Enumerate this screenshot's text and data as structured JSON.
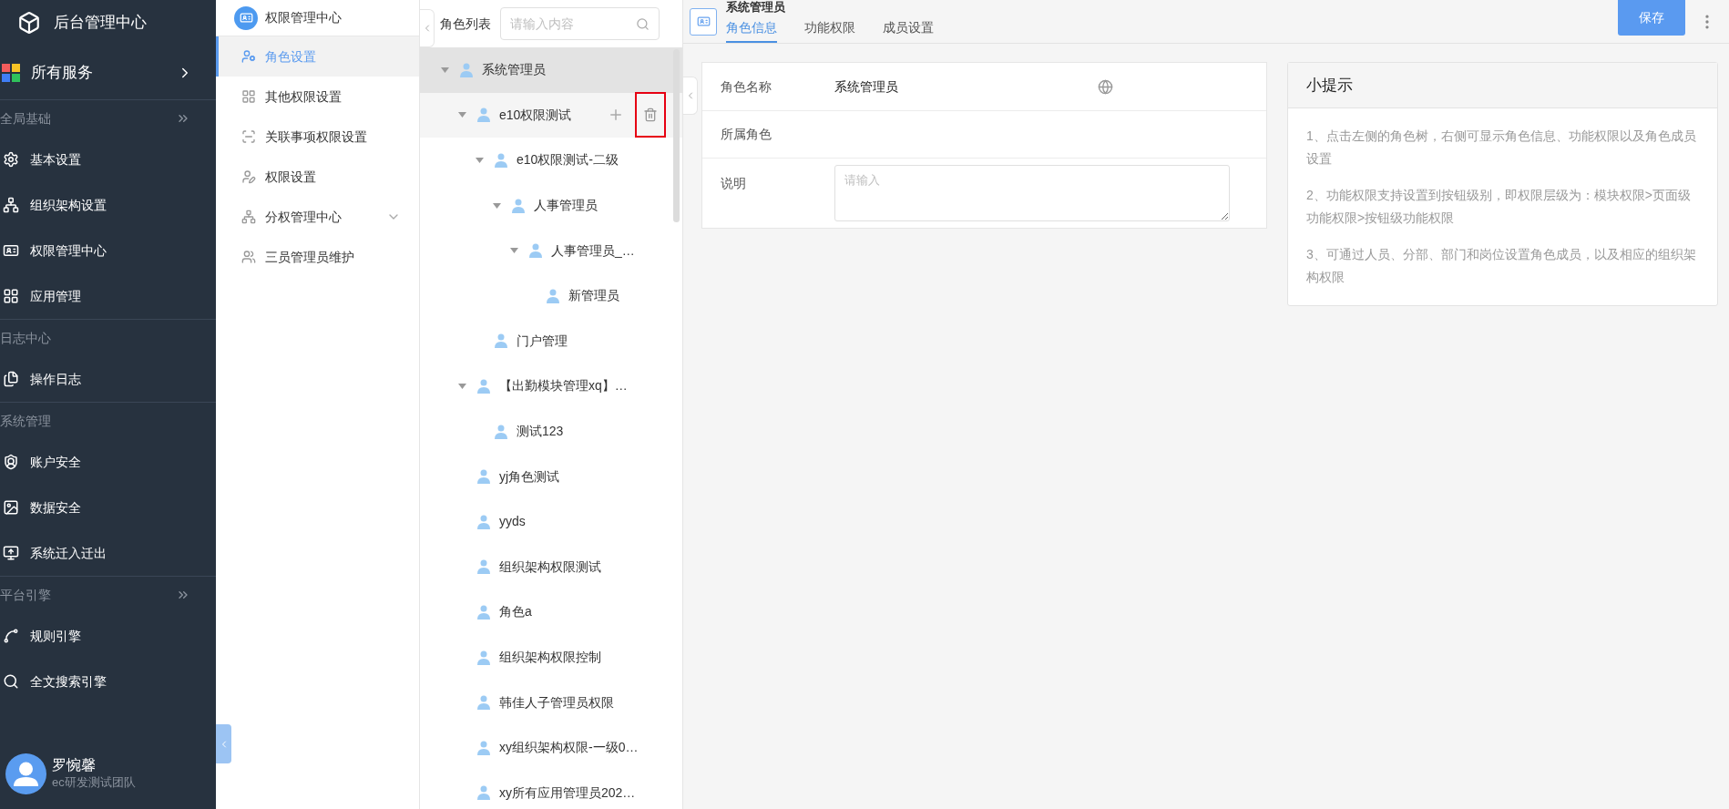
{
  "app": {
    "title": "后台管理中心"
  },
  "all_services": {
    "label": "所有服务"
  },
  "sidebar": {
    "sections": [
      {
        "label": "全局基础",
        "collapsible": true,
        "items": [
          {
            "label": "基本设置",
            "selected": false
          },
          {
            "label": "组织架构设置",
            "selected": false
          },
          {
            "label": "权限管理中心",
            "selected": false
          },
          {
            "label": "应用管理",
            "selected": false
          }
        ]
      },
      {
        "label": "日志中心",
        "collapsible": false,
        "items": [
          {
            "label": "操作日志",
            "selected": false
          }
        ]
      },
      {
        "label": "系统管理",
        "collapsible": false,
        "items": [
          {
            "label": "账户安全",
            "selected": false
          },
          {
            "label": "数据安全",
            "selected": false
          },
          {
            "label": "系统迁入迁出",
            "selected": false
          }
        ]
      },
      {
        "label": "平台引擎",
        "collapsible": true,
        "items": [
          {
            "label": "规则引擎",
            "selected": false
          },
          {
            "label": "全文搜索引擎",
            "selected": false
          }
        ]
      }
    ]
  },
  "user": {
    "name": "罗惋馨",
    "team": "ec研发测试团队"
  },
  "submenu": {
    "title": "权限管理中心",
    "items": [
      {
        "label": "角色设置",
        "kind": "link",
        "selected": true
      },
      {
        "label": "其他权限设置",
        "kind": "link",
        "selected": false
      },
      {
        "label": "关联事项权限设置",
        "kind": "link",
        "selected": false
      },
      {
        "label": "权限设置",
        "kind": "link",
        "selected": false
      },
      {
        "label": "分权管理中心",
        "kind": "group",
        "expanded": false,
        "selected": false
      },
      {
        "label": "三员管理员维护",
        "kind": "link",
        "selected": false
      }
    ]
  },
  "role_tree": {
    "title": "角色列表",
    "search": {
      "placeholder": "请输入内容"
    },
    "delete_highlighted": true,
    "nodes": [
      {
        "label": "系统管理员",
        "selected": true,
        "hovered": false,
        "expanded": true,
        "children": [
          {
            "label": "e10权限测试",
            "selected": false,
            "hovered": true,
            "expanded": true,
            "children": [
              {
                "label": "e10权限测试-二级",
                "selected": false,
                "hovered": false,
                "expanded": true,
                "children": [
                  {
                    "label": "人事管理员",
                    "selected": false,
                    "hovered": false,
                    "expanded": true,
                    "children": [
                      {
                        "label": "人事管理员_…",
                        "selected": false,
                        "hovered": false,
                        "expanded": true,
                        "children": [
                          {
                            "label": "新管理员",
                            "selected": false,
                            "hovered": false
                          }
                        ]
                      }
                    ]
                  }
                ]
              },
              {
                "label": "门户管理",
                "selected": false,
                "hovered": false
              }
            ]
          },
          {
            "label": "【出勤模块管理xq】…",
            "selected": false,
            "hovered": false,
            "expanded": true,
            "children": [
              {
                "label": "测试123",
                "selected": false,
                "hovered": false
              }
            ]
          },
          {
            "label": "yj角色测试",
            "selected": false,
            "hovered": false
          },
          {
            "label": "yyds",
            "selected": false,
            "hovered": false
          },
          {
            "label": "组织架构权限测试",
            "selected": false,
            "hovered": false
          },
          {
            "label": "角色a",
            "selected": false,
            "hovered": false
          },
          {
            "label": "组织架构权限控制",
            "selected": false,
            "hovered": false
          },
          {
            "label": "韩佳人子管理员权限",
            "selected": false,
            "hovered": false
          },
          {
            "label": "xy组织架构权限-一级0…",
            "selected": false,
            "hovered": false
          },
          {
            "label": "xy所有应用管理员202…",
            "selected": false,
            "hovered": false
          }
        ]
      }
    ]
  },
  "role_panel": {
    "title": "系统管理员",
    "tabs": [
      {
        "label": "角色信息",
        "selected": true
      },
      {
        "label": "功能权限",
        "selected": false
      },
      {
        "label": "成员设置",
        "selected": false
      }
    ],
    "save_button": "保存",
    "form": {
      "fields": [
        {
          "kind": "text",
          "label": "角色名称",
          "value": "系统管理员",
          "multilingual": true
        },
        {
          "kind": "text",
          "label": "所属角色",
          "multilingual": false
        },
        {
          "kind": "textarea",
          "label": "说明",
          "placeholder": "请输入"
        }
      ]
    },
    "tips": {
      "title": "小提示",
      "items": [
        "1、点击左侧的角色树，右侧可显示角色信息、功能权限以及角色成员设置",
        "2、功能权限支持设置到按钮级别，即权限层级为：模块权限>页面级功能权限>按钮级功能权限",
        "3、可通过人员、分部、部门和岗位设置角色成员，以及相应的组织架构权限"
      ]
    }
  }
}
